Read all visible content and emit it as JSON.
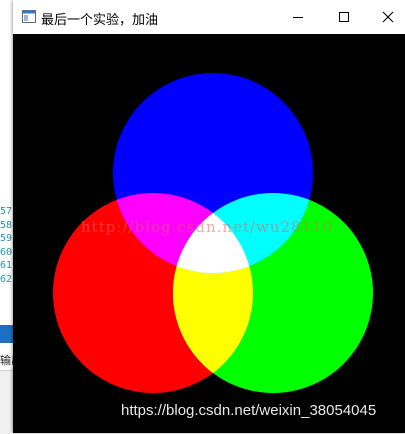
{
  "window": {
    "title": "最后一个实验，加油",
    "controls": {
      "minimize": "minimize-icon",
      "maximize": "maximize-icon",
      "close": "close-icon"
    }
  },
  "background_ide": {
    "line_numbers": [
      "57",
      "58",
      "59",
      "60",
      "61",
      "62"
    ],
    "output_label": "输出"
  },
  "canvas": {
    "background": "#000000",
    "circles": [
      {
        "name": "blue",
        "color": "#0000ff"
      },
      {
        "name": "red",
        "color": "#ff0000"
      },
      {
        "name": "green",
        "color": "#00ff00"
      }
    ],
    "overlaps": {
      "red_blue": "#ff00ff",
      "blue_green": "#00ffff",
      "red_green": "#ffff00",
      "all": "#ffffff"
    },
    "watermark_middle": "http://blog.csdn.net/wu28110",
    "watermark_bottom": "https://blog.csdn.net/weixin_38054045"
  }
}
